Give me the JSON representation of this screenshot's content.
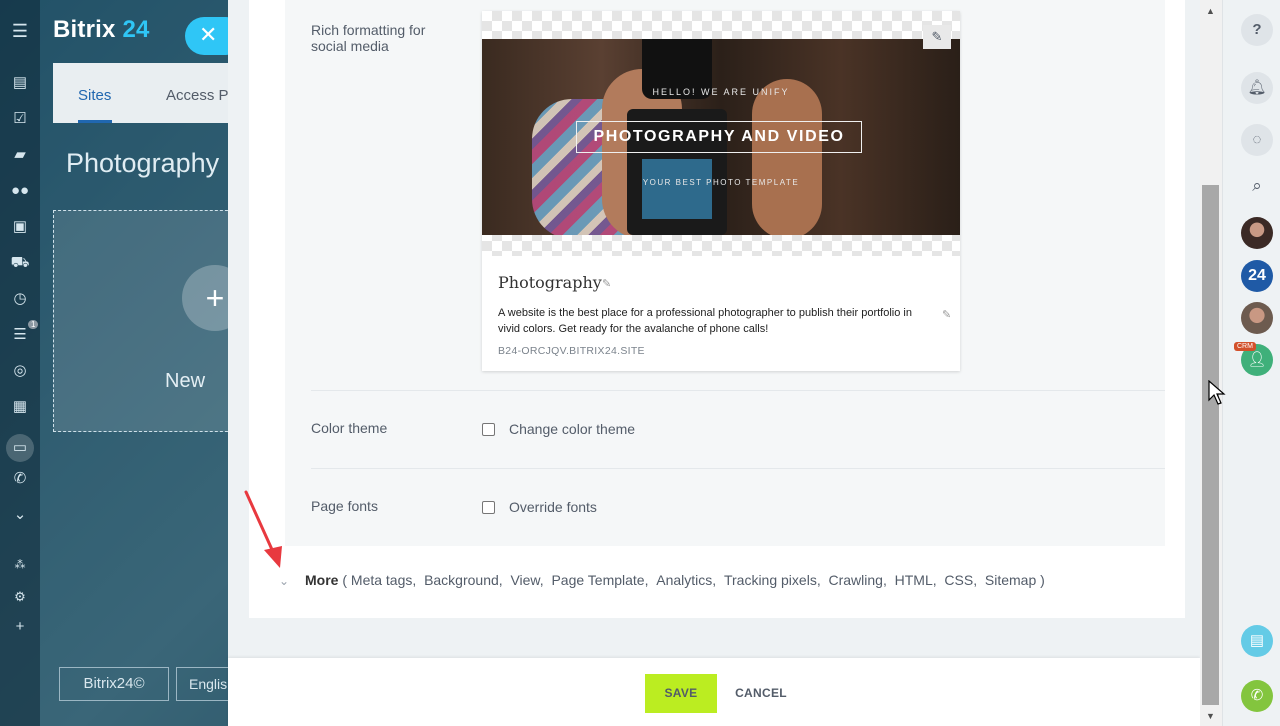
{
  "background_app": {
    "logo_text": "Bitrix",
    "logo_number": "24",
    "tabs": [
      {
        "label": "Sites"
      },
      {
        "label": "Access P"
      }
    ],
    "page_title": "Photography",
    "new_card_label": "New",
    "bottom_buttons": [
      {
        "label": "Bitrix24©"
      },
      {
        "label": "Englis"
      }
    ],
    "left_icons": [
      "menu-icon",
      "feed-icon",
      "tasks-icon",
      "chat-icon",
      "contacts-icon",
      "crm-icon",
      "shop-icon",
      "time-icon",
      "filter-icon",
      "goals-icon",
      "apps-icon",
      "sites-icon",
      "phone-icon",
      "more-icon",
      "structure-icon",
      "settings-icon",
      "add-icon"
    ],
    "filter_badge": "1"
  },
  "form": {
    "rich_formatting_label": "Rich formatting for social media",
    "preview": {
      "hello": "HELLO! WE ARE UNIFY",
      "banner_title": "PHOTOGRAPHY AND VIDEO",
      "banner_subtitle": "YOUR BEST PHOTO TEMPLATE",
      "title": "Photography",
      "description": "A website is the best place for a professional photographer to publish their portfolio in vivid colors. Get ready for the avalanche of phone calls!",
      "domain": "B24-ORCJQV.BITRIX24.SITE"
    },
    "color_theme": {
      "label": "Color theme",
      "checkbox_label": "Change color theme",
      "checked": false
    },
    "page_fonts": {
      "label": "Page fonts",
      "checkbox_label": "Override fonts",
      "checked": false
    },
    "more": {
      "label": "More",
      "open_paren": " ( ",
      "close_paren": " )",
      "items": [
        "Meta tags,",
        "Background,",
        "View,",
        "Page Template,",
        "Analytics,",
        "Tracking pixels,",
        "Crawling,",
        "HTML,",
        "CSS,",
        "Sitemap"
      ]
    }
  },
  "footer": {
    "save_label": "SAVE",
    "cancel_label": "CANCEL"
  },
  "right_bar": {
    "help": "?",
    "badge_24": "24",
    "crm_badge": "CRM"
  },
  "colors": {
    "accent_blue": "#2fc6f6",
    "save_green": "#bbed21",
    "link_blue": "#2067b0",
    "arrow_red": "#e8393f"
  }
}
